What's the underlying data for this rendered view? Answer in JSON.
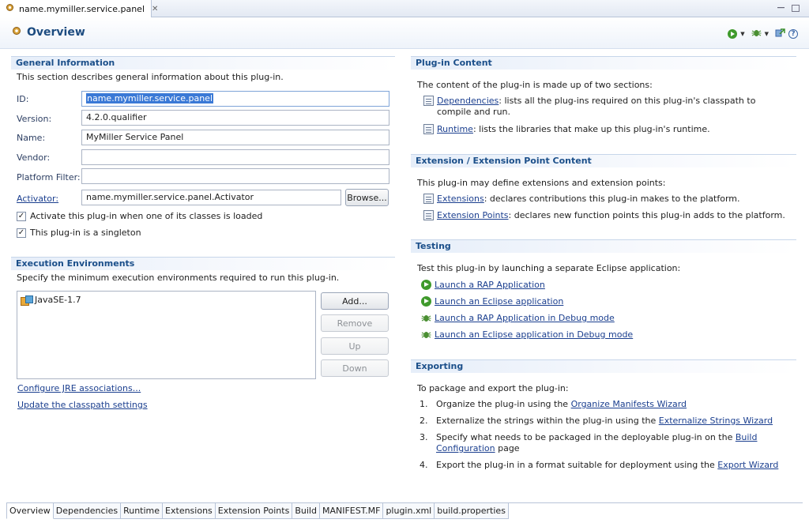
{
  "editor_tab": {
    "title": "name.mymiller.service.panel",
    "close": "✕"
  },
  "header": {
    "title": "Overview",
    "help": "?"
  },
  "general": {
    "title": "General Information",
    "description": "This section describes general information about this plug-in.",
    "id_label": "ID:",
    "id_value": "name.mymiller.service.panel",
    "version_label": "Version:",
    "version_value": "4.2.0.qualifier",
    "name_label": "Name:",
    "name_value": "MyMiller Service Panel",
    "vendor_label": "Vendor:",
    "vendor_value": "",
    "platform_label": "Platform Filter:",
    "platform_value": "",
    "activator_label": "Activator:",
    "activator_value": "name.mymiller.service.panel.Activator",
    "browse": "Browse...",
    "activate_checkbox": "Activate this plug-in when one of its classes is loaded",
    "singleton_checkbox": "This plug-in is a singleton",
    "check_mark": "✓"
  },
  "exec_env": {
    "title": "Execution Environments",
    "description": "Specify the minimum execution environments required to run this plug-in.",
    "items": [
      "JavaSE-1.7"
    ],
    "add": "Add...",
    "remove": "Remove",
    "up": "Up",
    "down": "Down",
    "configure_link": "Configure JRE associations...",
    "update_link": "Update the classpath settings"
  },
  "plugin_content": {
    "title": "Plug-in Content",
    "description": "The content of the plug-in is made up of two sections:",
    "dependencies_link": "Dependencies",
    "dependencies_text": ": lists all the plug-ins required on this plug-in's classpath to compile and run.",
    "runtime_link": "Runtime",
    "runtime_text": ": lists the libraries that make up this plug-in's runtime."
  },
  "extension_content": {
    "title": "Extension / Extension Point Content",
    "description": "This plug-in may define extensions and extension points:",
    "extensions_link": "Extensions",
    "extensions_text": ": declares contributions this plug-in makes to the platform.",
    "points_link": "Extension Points",
    "points_text": ": declares new function points this plug-in adds to the platform."
  },
  "testing": {
    "title": "Testing",
    "description": "Test this plug-in by launching a separate Eclipse application:",
    "links": [
      "Launch a RAP Application",
      "Launch an Eclipse application",
      "Launch a RAP Application in Debug mode",
      "Launch an Eclipse application in Debug mode"
    ]
  },
  "exporting": {
    "title": "Exporting",
    "description": "To package and export the plug-in:",
    "steps": [
      {
        "num": "1.",
        "pre": "Organize the plug-in using the ",
        "link": "Organize Manifests Wizard",
        "post": ""
      },
      {
        "num": "2.",
        "pre": "Externalize the strings within the plug-in using the ",
        "link": "Externalize Strings Wizard",
        "post": ""
      },
      {
        "num": "3.",
        "pre": "Specify what needs to be packaged in the deployable plug-in on the ",
        "link": "Build Configuration",
        "post": " page"
      },
      {
        "num": "4.",
        "pre": "Export the plug-in in a format suitable for deployment using the ",
        "link": "Export Wizard",
        "post": ""
      }
    ]
  },
  "bottom_tabs": [
    "Overview",
    "Dependencies",
    "Runtime",
    "Extensions",
    "Extension Points",
    "Build",
    "MANIFEST.MF",
    "plugin.xml",
    "build.properties"
  ]
}
